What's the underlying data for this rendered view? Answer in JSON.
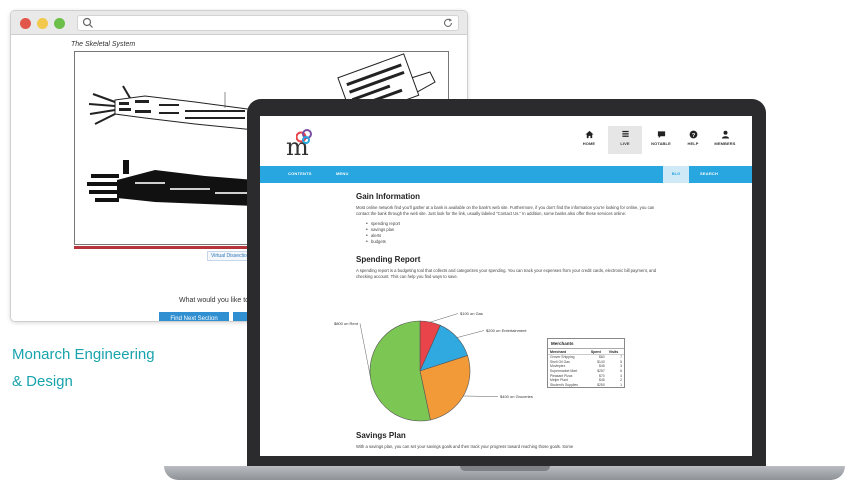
{
  "browser": {
    "content_title": "The Skeletal System",
    "caption": "Virtual Dissection",
    "question": "What would you like to do?",
    "find_button": "Find Next Section"
  },
  "tagline": {
    "line1": "Monarch Engineering",
    "line2": "& Design"
  },
  "app": {
    "logo_text": "m",
    "nav": [
      {
        "label": "HOME",
        "icon": "home-icon"
      },
      {
        "label": "LIVE",
        "icon": "document-icon"
      },
      {
        "label": "NOTABLE",
        "icon": "chat-icon"
      },
      {
        "label": "HELP",
        "icon": "help-icon"
      },
      {
        "label": "MEMBERS",
        "icon": "user-icon"
      }
    ],
    "bluebar": {
      "left_items": [
        "CONTENTS",
        "MENU"
      ],
      "tab_label": "BLG",
      "right_item": "SEARCH"
    }
  },
  "article": {
    "gain_title": "Gain Information",
    "gain_para": "Most online network find you'll gather at a bank is available on the bank's web site. Furthermore, if you don't find the information you're looking for online, you can contact the bank through the web site. Just look for the link, usually labeled \"Contact Us.\" In addition, some banks also offer these services online:",
    "bullets": [
      "spending report",
      "savings plan",
      "alerts",
      "budgets"
    ],
    "spending_title": "Spending Report",
    "spending_para": "A spending report is a budgeting tool that collects and categorizes your spending. You can track your expenses from your credit cards, electronic bill payment, and checking account. This can help you find ways to save.",
    "savings_title": "Savings Plan",
    "savings_para": "With a savings plan, you can set your savings goals and then track your progress toward reaching those goals. Some"
  },
  "chart_data": {
    "type": "pie",
    "slices": [
      {
        "label": "$100 on Gas",
        "value": 100,
        "color": "#e8444a"
      },
      {
        "label": "$200 on Entertainment",
        "value": 200,
        "color": "#2fa9e0"
      },
      {
        "label": "$400 on Groceries",
        "value": 400,
        "color": "#f29a38"
      },
      {
        "label": "$800 on Rent",
        "value": 800,
        "color": "#7cc653"
      }
    ]
  },
  "merchants": {
    "title": "Merchants",
    "headers": [
      "Merchant",
      "Spent",
      "Visits"
    ],
    "rows": [
      [
        "Grover Shipping",
        "$60",
        "7"
      ],
      [
        "Shell Oil Gas",
        "$140",
        "5"
      ],
      [
        "Movieplex",
        "$45",
        "3"
      ],
      [
        "Supermarket Mart",
        "$257",
        "6"
      ],
      [
        "Pleasant Pizza",
        "$70",
        "4"
      ],
      [
        "Meijer Plant",
        "$45",
        "2"
      ],
      [
        "Student's Supplies",
        "$250",
        "1"
      ]
    ]
  }
}
